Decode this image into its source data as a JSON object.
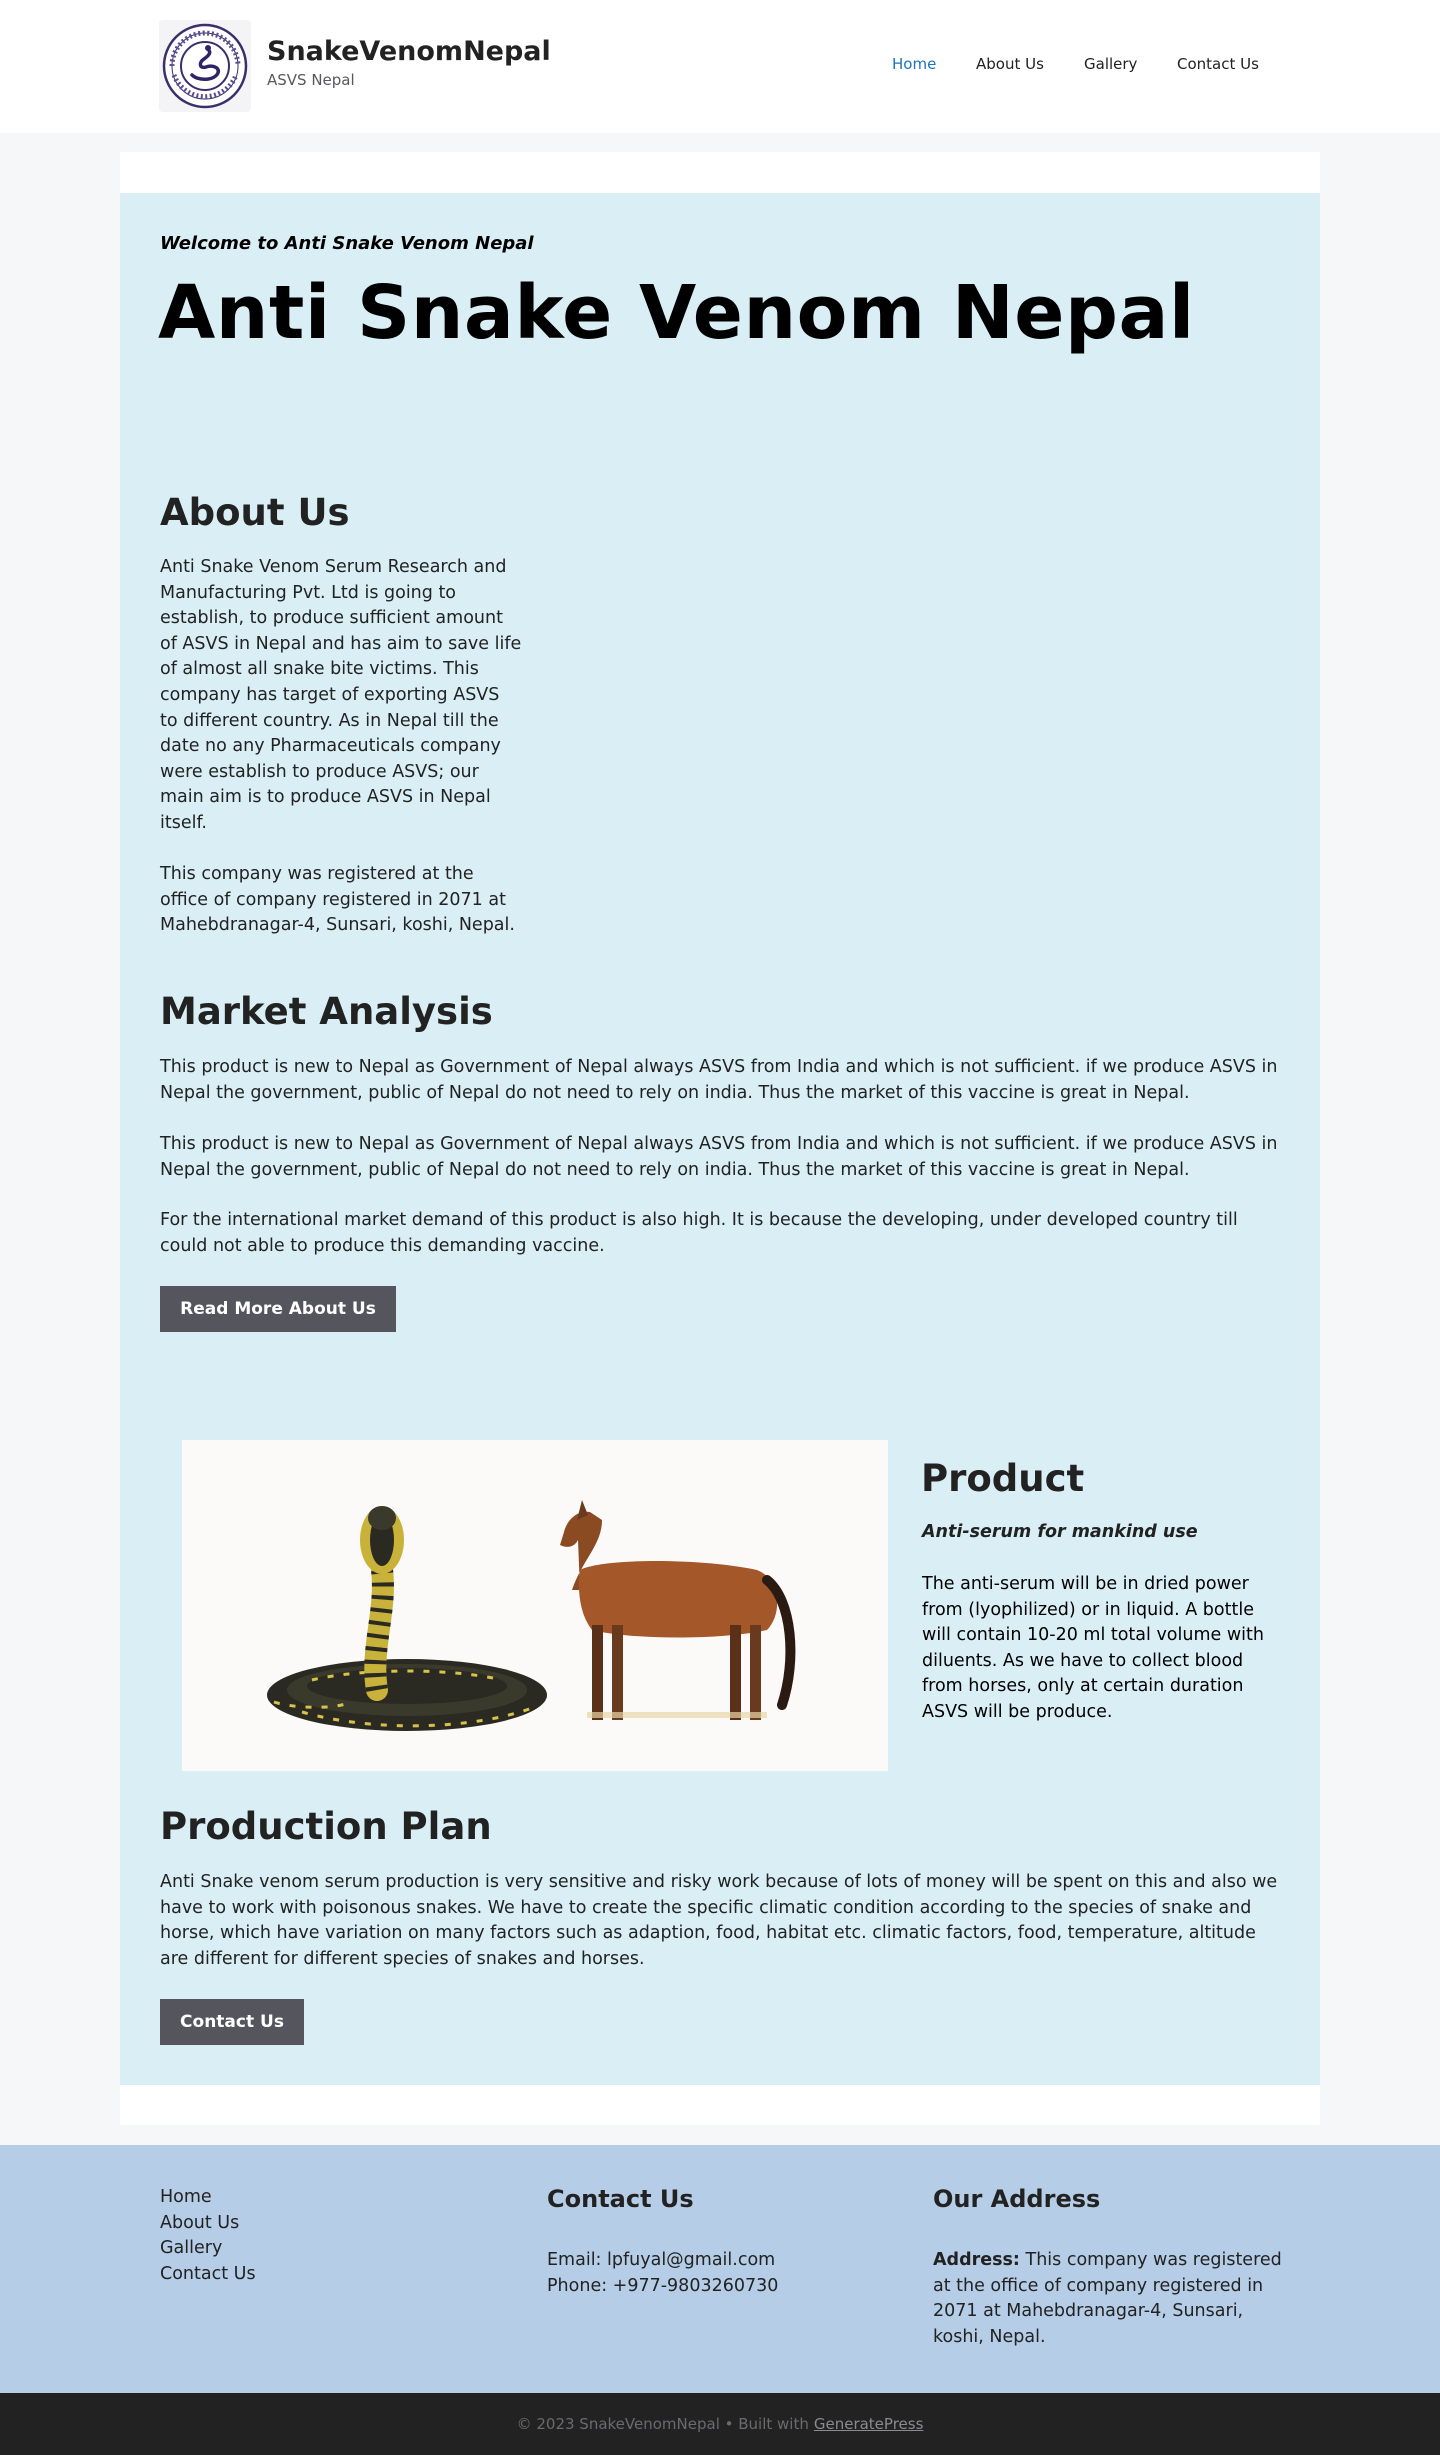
{
  "header": {
    "site_title": "SnakeVenomNepal",
    "tagline": "ASVS Nepal",
    "logo_icon": "company-seal-logo",
    "nav": [
      {
        "label": "Home",
        "active": true
      },
      {
        "label": "About Us",
        "active": false
      },
      {
        "label": "Gallery",
        "active": false
      },
      {
        "label": "Contact Us",
        "active": false
      }
    ]
  },
  "hero": {
    "welcome": "Welcome to Anti Snake Venom Nepal",
    "title": "Anti Snake Venom Nepal"
  },
  "about": {
    "heading": "About Us",
    "p1": "Anti Snake Venom Serum Research and Manufacturing Pvt. Ltd is going to establish, to produce sufficient amount of ASVS in Nepal and has aim to save life of almost all snake bite victims. This company has target of exporting ASVS to different country. As in Nepal till the date no any Pharmaceuticals company were establish to produce ASVS; our main aim is to produce ASVS in Nepal itself.",
    "p2": "This company was registered at the office of company registered in 2071 at Mahebdranagar-4, Sunsari, koshi, Nepal."
  },
  "market": {
    "heading": "Market Analysis",
    "p1": "This product is new to Nepal as Government of Nepal always ASVS from India and which is not sufficient. if we produce ASVS in Nepal the government, public of Nepal do not need to rely on india. Thus the market of this vaccine is great in Nepal.",
    "p2": "This product is new to Nepal as Government of Nepal always ASVS from India and which is not sufficient. if we produce ASVS in Nepal the government, public of Nepal do not need to rely on india. Thus the market of this vaccine is great in Nepal.",
    "p3": "For the international market demand of this product is also high. It is because the developing, under developed country till could not able to produce this demanding vaccine.",
    "button": "Read More About Us"
  },
  "product": {
    "heading": "Product",
    "subtitle": "Anti-serum for mankind use",
    "text": "The anti-serum will be in dried power from (lyophilized) or in liquid. A bottle will contain 10-20 ml total volume with diluents. As we have to collect blood from horses, only at certain duration ASVS will be produce.",
    "image_icon": "cobra-and-horse-illustration"
  },
  "production": {
    "heading": "Production Plan",
    "text": "Anti Snake venom serum production is very sensitive and risky work because of lots of money will be spent on this and also we have to work with poisonous snakes. We have to create the specific climatic condition according to the species of snake and horse, which have variation on many factors such as adaption, food, habitat etc. climatic factors, food, temperature, altitude are different for different species of snakes and horses.",
    "button": "Contact Us"
  },
  "footer": {
    "links": [
      "Home",
      "About Us",
      "Gallery",
      "Contact Us"
    ],
    "contact_heading": "Contact Us",
    "email": "Email: lpfuyal@gmail.com",
    "phone": "Phone: +977-9803260730",
    "address_heading": "Our Address",
    "address_label": "Address:",
    "address_text": "This company was registered at the office of company registered in 2071 at Mahebdranagar-4, Sunsari, koshi, Nepal.",
    "copyright": "© 2023 SnakeVenomNepal • Built with",
    "credit_link": "GeneratePress"
  },
  "colors": {
    "accent": "#1e73be",
    "hero_bg": "#d9eff5",
    "footer_bg": "#b5cde6",
    "button_bg": "#55555e",
    "bottom_bar_bg": "#222222"
  }
}
